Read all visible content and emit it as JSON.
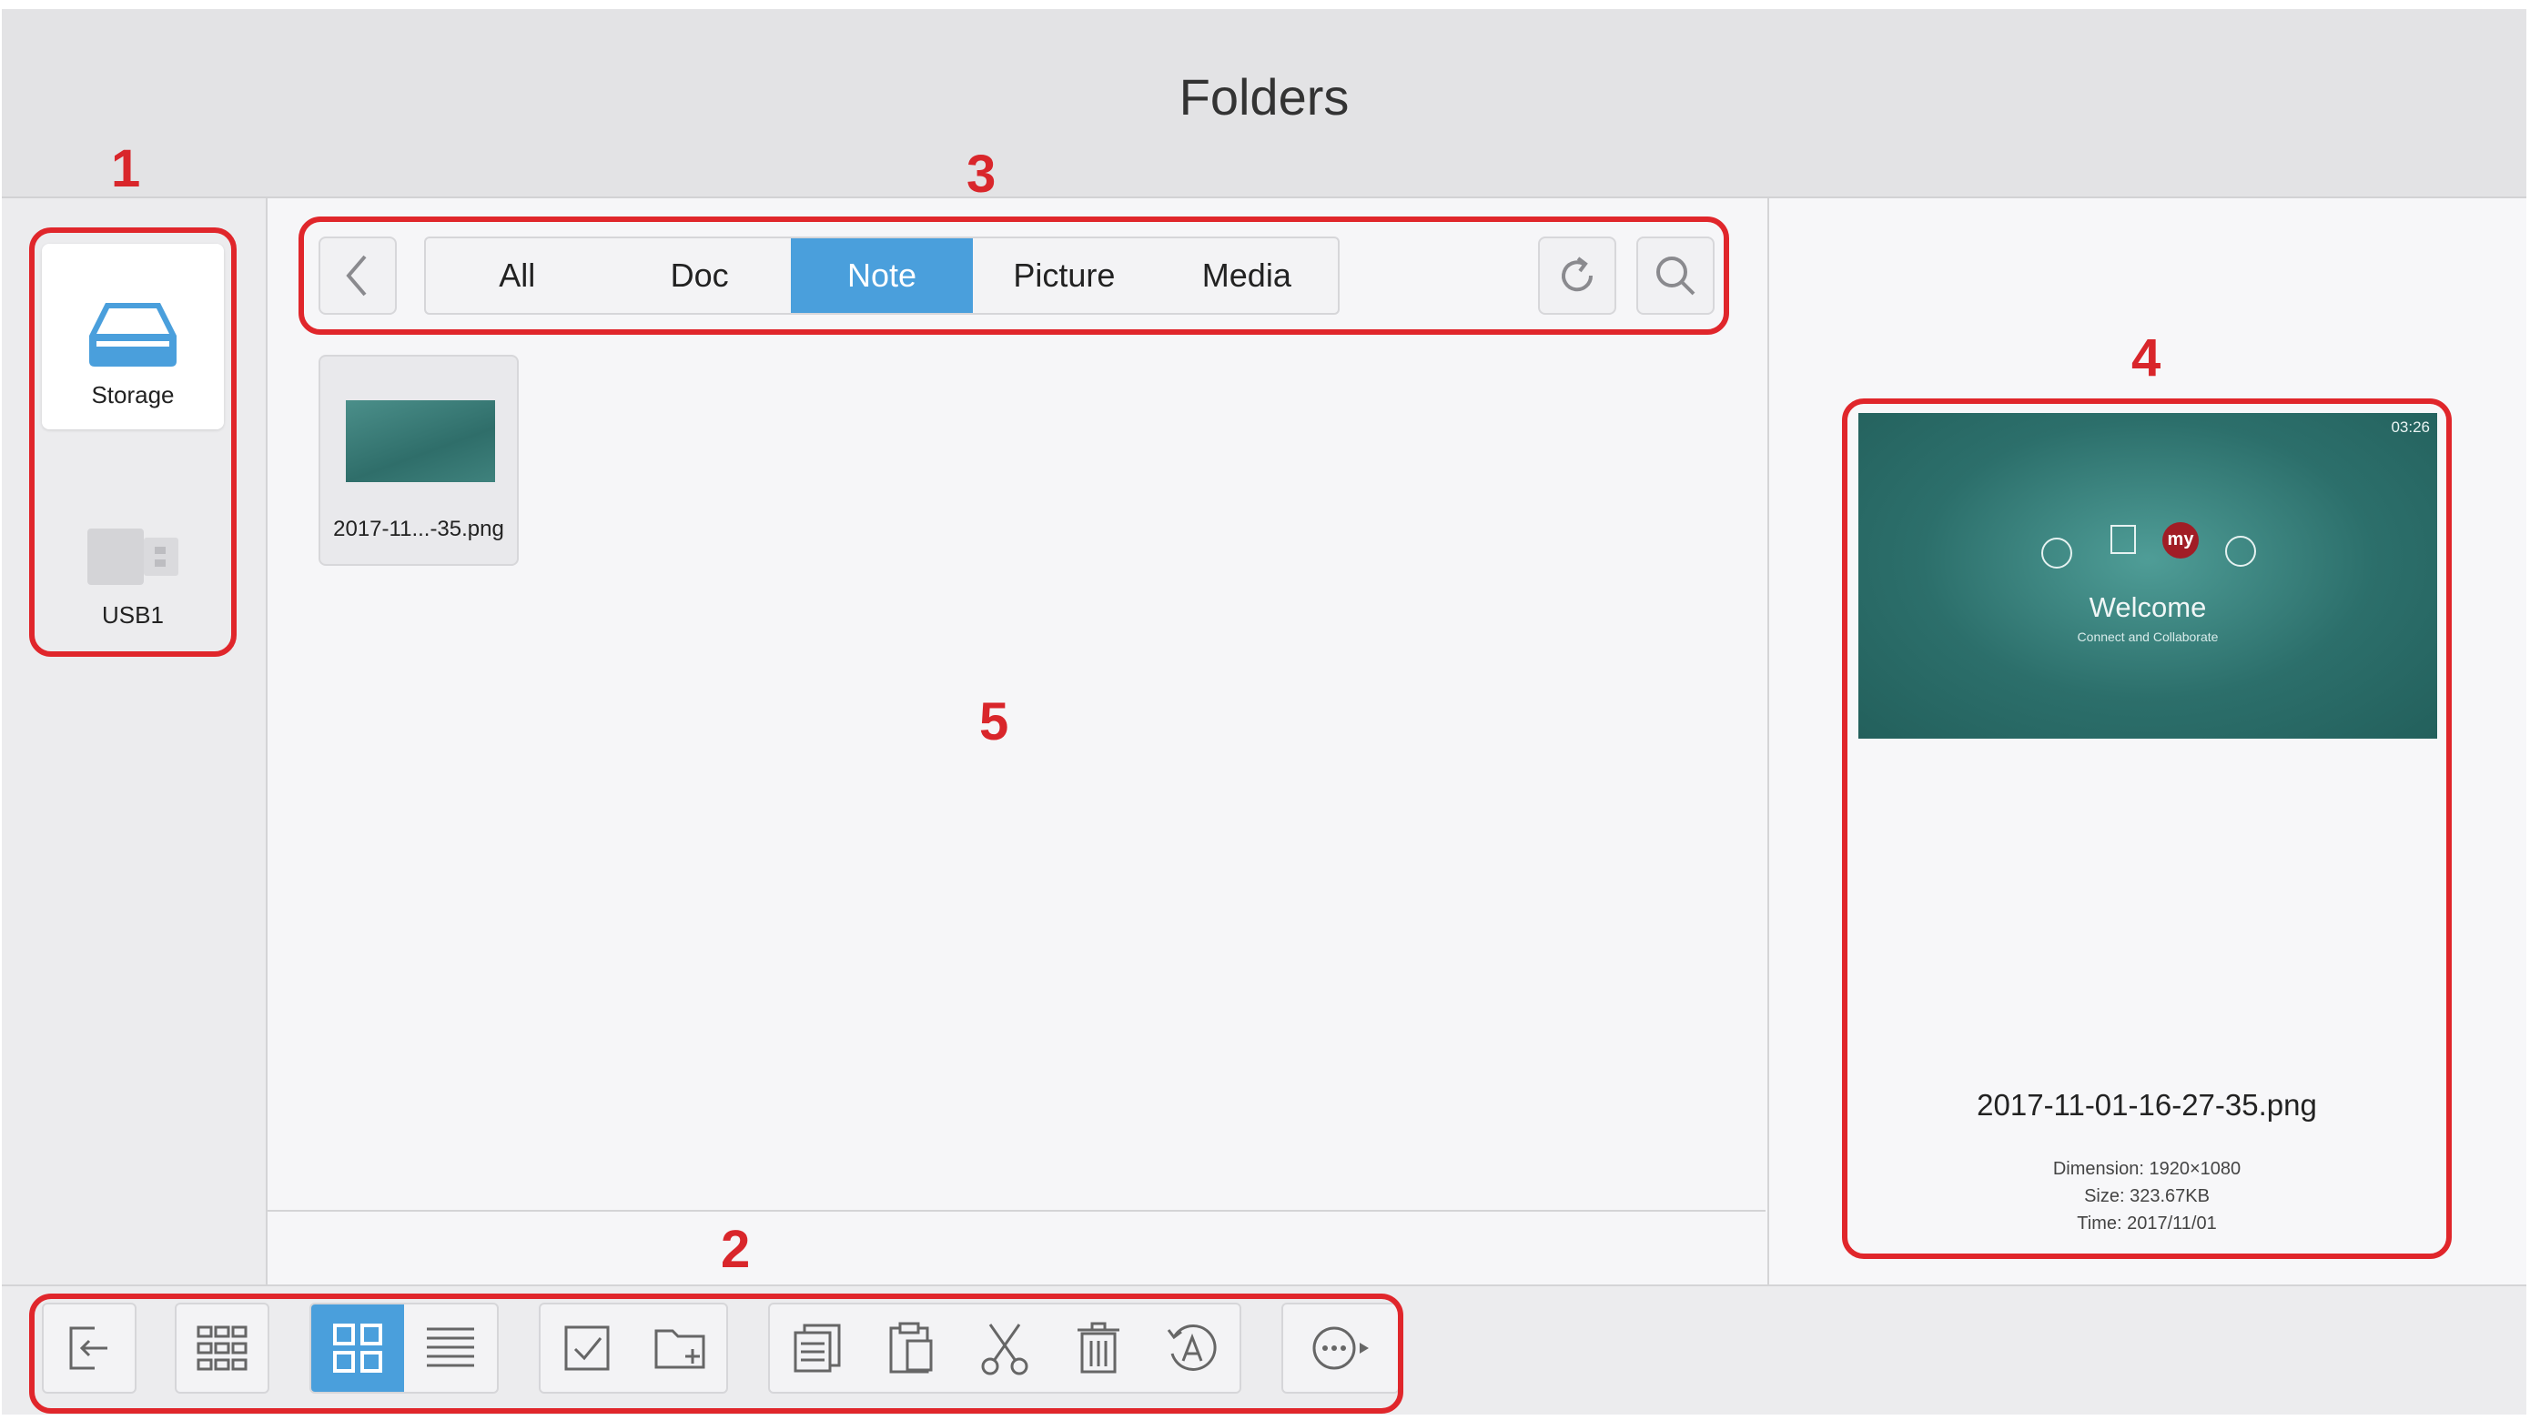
{
  "header": {
    "title": "Folders"
  },
  "sidebar": {
    "drives": [
      {
        "label": "Storage",
        "icon": "storage-icon",
        "selected": true
      },
      {
        "label": "USB1",
        "icon": "usb-drive-icon",
        "selected": false
      }
    ]
  },
  "filter_bar": {
    "back_icon": "chevron-left-icon",
    "tabs": [
      "All",
      "Doc",
      "Note",
      "Picture",
      "Media"
    ],
    "active_tab": "Note",
    "refresh_icon": "refresh-icon",
    "search_icon": "search-icon"
  },
  "files": [
    {
      "name": "2017-11...-35.png"
    }
  ],
  "preview": {
    "clock": "03:26",
    "welcome_title": "Welcome",
    "welcome_subtitle": "Connect and Collaborate",
    "app_badge": "my",
    "filename": "2017-11-01-16-27-35.png",
    "dimension": "Dimension: 1920×1080",
    "size": "Size: 323.67KB",
    "time": "Time: 2017/11/01"
  },
  "toolbar": {
    "exit_icon": "exit-icon",
    "apps_icon": "apps-grid-icon",
    "view_modes": [
      "thumbnail-view-icon",
      "list-view-icon"
    ],
    "active_view": "thumbnail-view-icon",
    "select_icon": "select-checkbox-icon",
    "new_folder_icon": "new-folder-icon",
    "edit_icons": [
      "copy-icon",
      "paste-icon",
      "cut-icon",
      "delete-icon",
      "rename-icon"
    ],
    "more_icon": "more-icon"
  },
  "annotations": {
    "accent": "#e0262b",
    "labels": [
      "1",
      "2",
      "3",
      "4",
      "5"
    ]
  },
  "colors": {
    "accent_blue": "#4a9fdc",
    "annotation_red": "#e0262b"
  }
}
